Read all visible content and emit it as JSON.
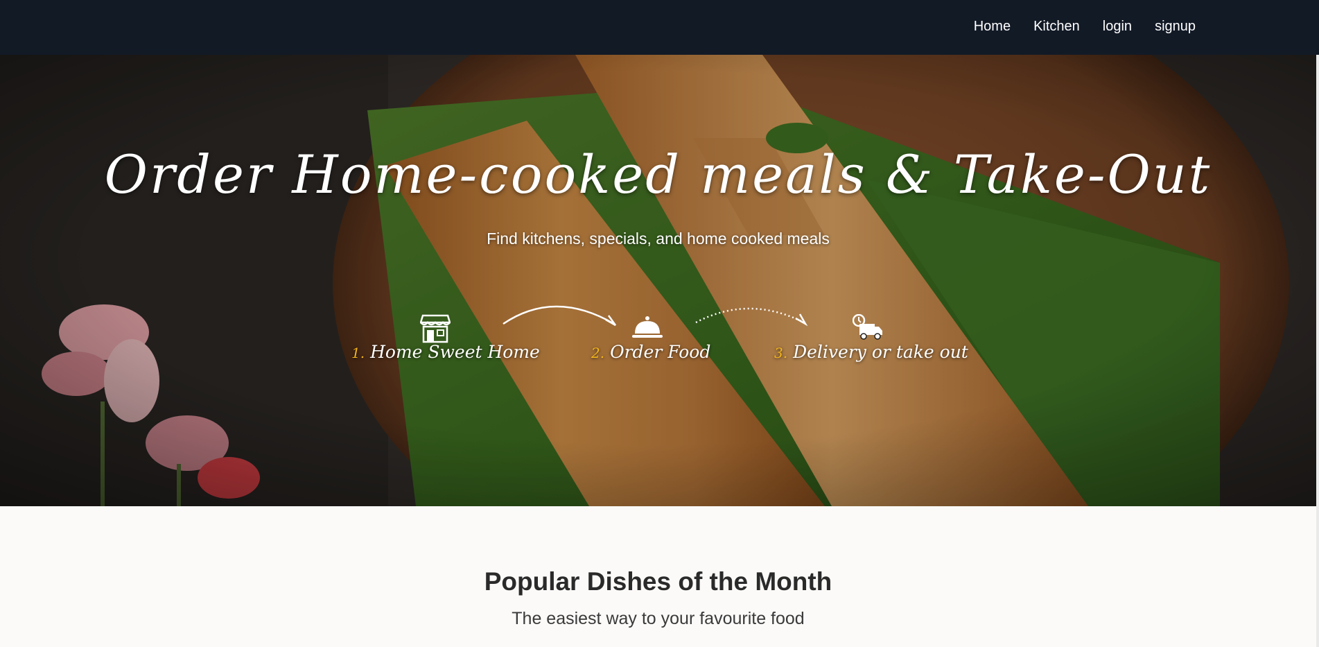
{
  "nav": {
    "links": [
      {
        "label": "Home"
      },
      {
        "label": "Kitchen"
      },
      {
        "label": "login"
      },
      {
        "label": "signup"
      }
    ]
  },
  "hero": {
    "title": "Order Home-cooked meals & Take-Out",
    "subtitle": "Find kitchens, specials, and home cooked meals",
    "steps": [
      {
        "number": "1.",
        "label": "Home Sweet Home",
        "icon": "storefront-icon"
      },
      {
        "number": "2.",
        "label": "Order Food",
        "icon": "serving-cloche-icon"
      },
      {
        "number": "3.",
        "label": "Delivery or take out",
        "icon": "delivery-truck-icon"
      }
    ]
  },
  "popular": {
    "title": "Popular Dishes of the Month",
    "subtitle": "The easiest way to your favourite food"
  },
  "colors": {
    "navbar": "#121a26",
    "step_number": "#f2b51b",
    "page_background": "#fbfaf8"
  }
}
